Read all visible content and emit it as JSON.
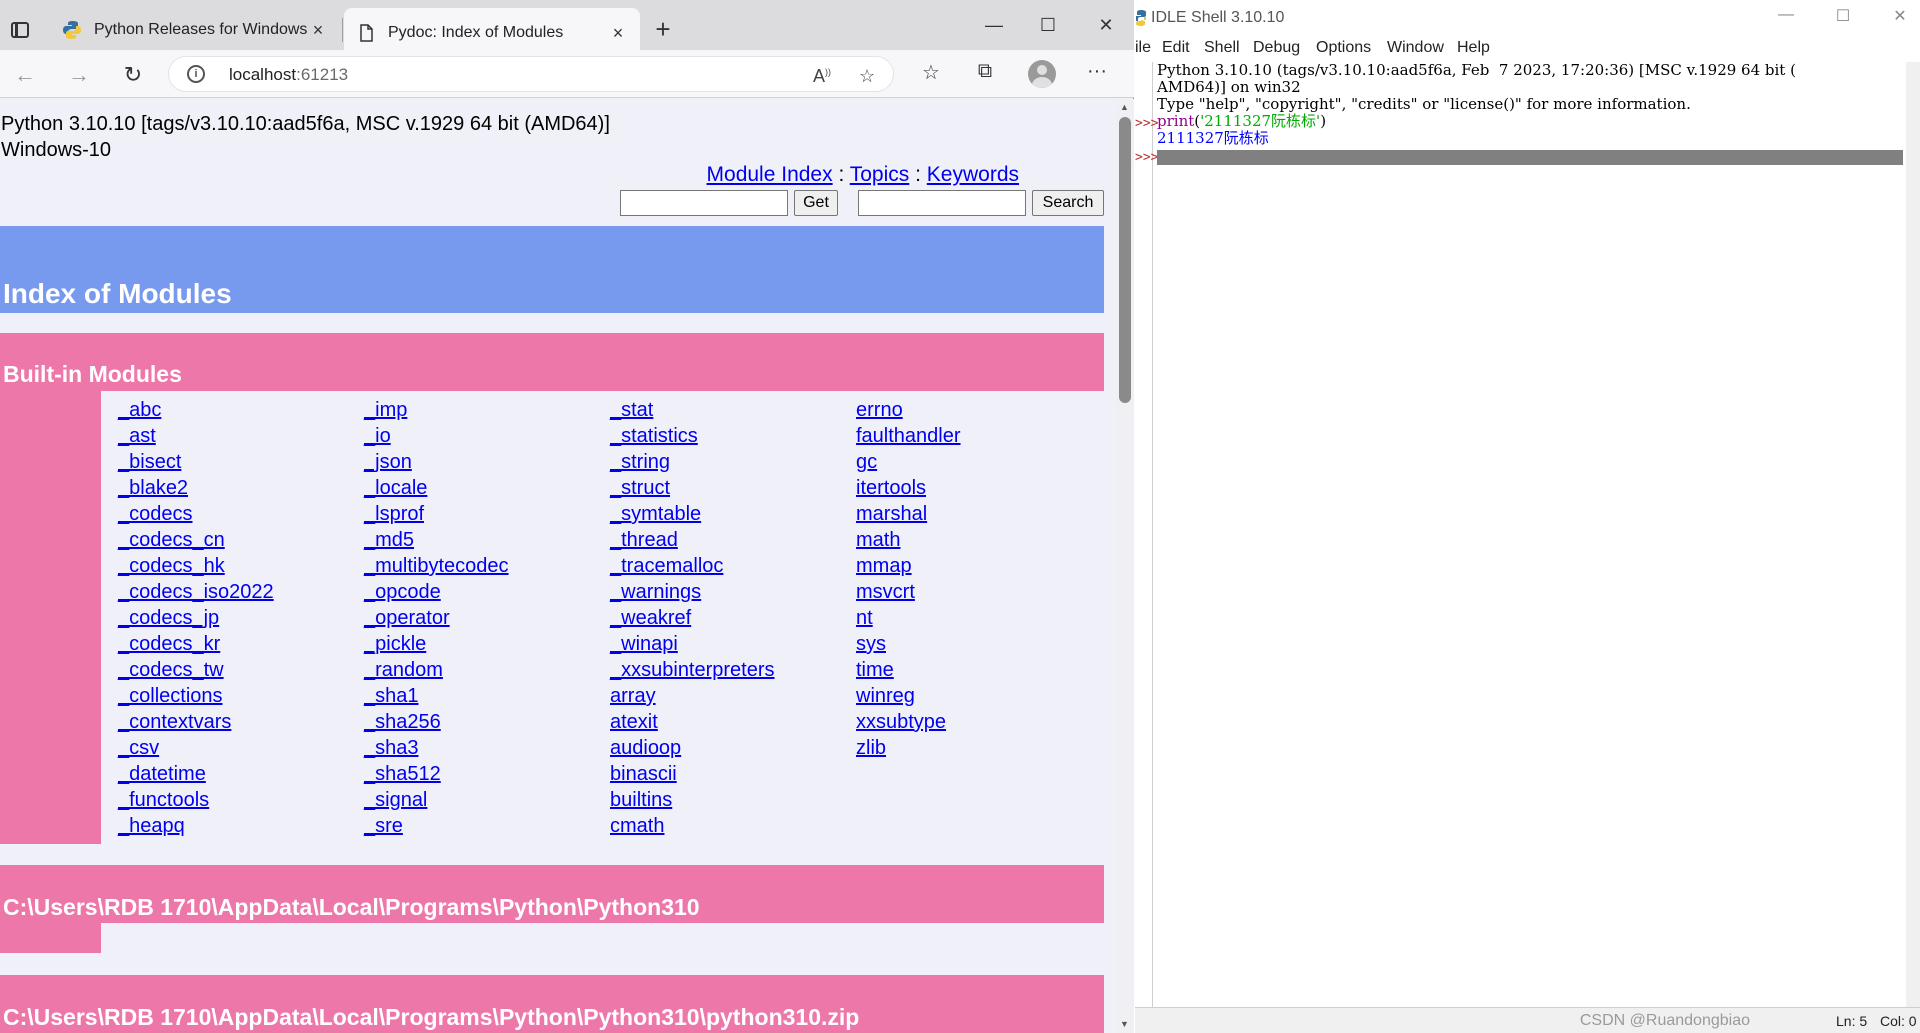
{
  "browser": {
    "tabs": [
      {
        "title": "Python Releases for Windows | P",
        "close": "×",
        "active": false
      },
      {
        "title": "Pydoc: Index of Modules",
        "close": "×",
        "active": true
      }
    ],
    "new_tab": "+",
    "window_controls": {
      "minimize": "—",
      "maximize": "☐",
      "close": "✕"
    },
    "nav": {
      "back": "←",
      "forward": "→",
      "refresh": "↻"
    },
    "address": {
      "host": "localhost",
      "port": ":61213"
    },
    "toolbar_icons": [
      "read-aloud-icon",
      "favorite-add-icon",
      "favorites-icon",
      "collections-icon",
      "profile-icon",
      "more-icon"
    ],
    "more": "···"
  },
  "page": {
    "version_line1": "Python 3.10.10 [tags/v3.10.10:aad5f6a, MSC v.1929 64 bit (AMD64)]",
    "version_line2": "Windows-10",
    "links": {
      "module_index": "Module Index",
      "sep1": " : ",
      "topics": "Topics",
      "sep2": " : ",
      "keywords": "Keywords"
    },
    "get_button": "Get",
    "search_button": "Search",
    "get_value": "",
    "search_value": "",
    "title": "Index of Modules",
    "builtin_heading": "Built-in Modules",
    "modules_col1": [
      "_abc",
      "_ast",
      "_bisect",
      "_blake2",
      "_codecs",
      "_codecs_cn",
      "_codecs_hk",
      "_codecs_iso2022",
      "_codecs_jp",
      "_codecs_kr",
      "_codecs_tw",
      "_collections",
      "_contextvars",
      "_csv",
      "_datetime",
      "_functools",
      "_heapq"
    ],
    "modules_col2": [
      "_imp",
      "_io",
      "_json",
      "_locale",
      "_lsprof",
      "_md5",
      "_multibytecodec",
      "_opcode",
      "_operator",
      "_pickle",
      "_random",
      "_sha1",
      "_sha256",
      "_sha3",
      "_sha512",
      "_signal",
      "_sre"
    ],
    "modules_col3": [
      "_stat",
      "_statistics",
      "_string",
      "_struct",
      "_symtable",
      "_thread",
      "_tracemalloc",
      "_warnings",
      "_weakref",
      "_winapi",
      "_xxsubinterpreters",
      "array",
      "atexit",
      "audioop",
      "binascii",
      "builtins",
      "cmath"
    ],
    "modules_col4": [
      "errno",
      "faulthandler",
      "gc",
      "itertools",
      "marshal",
      "math",
      "mmap",
      "msvcrt",
      "nt",
      "sys",
      "time",
      "winreg",
      "xxsubtype",
      "zlib"
    ],
    "path1": "C:\\Users\\RDB 1710\\AppData\\Local\\Programs\\Python\\Python310",
    "path2": "C:\\Users\\RDB 1710\\AppData\\Local\\Programs\\Python\\Python310\\python310.zip"
  },
  "idle": {
    "title": "IDLE Shell 3.10.10",
    "controls": {
      "minimize": "—",
      "maximize": "☐",
      "close": "✕"
    },
    "menu": [
      "ile",
      "Edit",
      "Shell",
      "Debug",
      "Options",
      "Window",
      "Help"
    ],
    "lines": {
      "l1": "Python 3.10.10 (tags/v3.10.10:aad5f6a, Feb  7 2023, 17:20:36) [MSC v.1929 64 bit (",
      "l2": "AMD64)] on win32",
      "l3": "Type \"help\", \"copyright\", \"credits\" or \"license()\" for more information.",
      "l4_kw": "print",
      "l4_open": "(",
      "l4_str": "'2111327阮栋标'",
      "l4_close": ")",
      "l5": "2111327阮栋标"
    },
    "prompt": ">>>",
    "status": {
      "ln": "Ln: 5",
      "col": "Col: 0"
    },
    "watermark": "CSDN @Ruandongbiao"
  },
  "colors": {
    "heading_bg": "#7799ee",
    "section_bg": "#ee77aa",
    "link": "#0000ee",
    "page_bg": "#f0f0f8"
  }
}
